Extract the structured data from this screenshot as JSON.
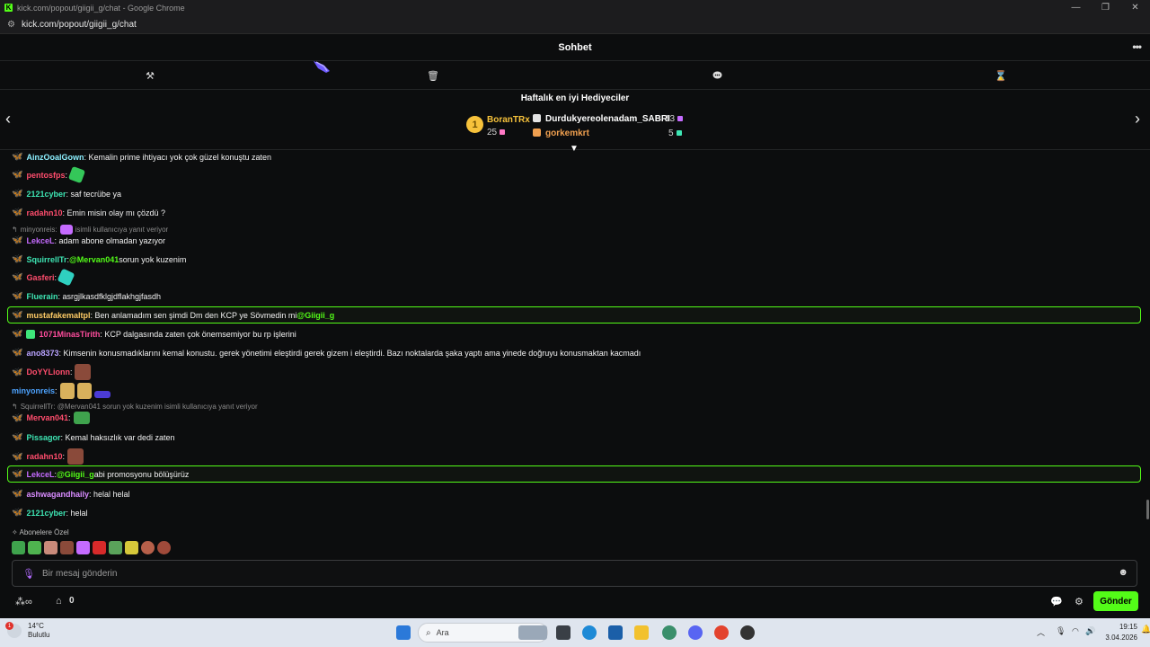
{
  "browser": {
    "title": "kick.com/popout/giigii_g/chat - Google Chrome",
    "url": "kick.com/popout/giigii_g/chat"
  },
  "header": {
    "title": "Sohbet"
  },
  "gifters": {
    "title": "Haftalık en iyi Hediyeciler",
    "first": {
      "rank": "1",
      "name": "BoranTRx",
      "count": "25"
    },
    "second": {
      "name": "Durdukyereolenadam_SABRI",
      "count": "13"
    },
    "third": {
      "name": "gorkemkrt",
      "count": "5"
    }
  },
  "messages": [
    {
      "user": "AinzOoalGown",
      "text": ": Kemalin prime ihtiyacı yok çok güzel konuştu zaten",
      "color": "#8cf0ff"
    },
    {
      "user": "pentosfps",
      "text": ":",
      "color": "#ff4d6d"
    },
    {
      "user": "2121cyber",
      "text": ": saf tecrübe ya",
      "color": "#3ee6b4"
    },
    {
      "user": "radahn10",
      "text": ": Emin misin olay mı çözdü ?",
      "color": "#ff4d6d"
    },
    {
      "reply_user": "minyonreis:",
      "reply_text": "isimli kullanıcıya yanıt veriyor"
    },
    {
      "user": "LekceL",
      "text": ": adam abone olmadan yazıyor",
      "color": "#c56bff"
    },
    {
      "user": "SquirrellTr",
      "text": ": ",
      "mention": "@Mervan041",
      "after": " sorun yok kuzenim",
      "color": "#3ee6b4"
    },
    {
      "user": "Gasferi",
      "text": ":",
      "color": "#ff4d6d"
    },
    {
      "user": "Fluerain",
      "text": ": asrgjlkasdfklgjdflakhgjfasdh",
      "color": "#3ee6b4"
    },
    {
      "user": "mustafakemaltpl",
      "text": ": Ben anlamadım sen şimdi Dm den KCP ye Sövmedin mi ",
      "mention": "@Giigii_g",
      "color": "#ffcc66"
    },
    {
      "user": "1071MinasTirith",
      "text": ": KCP dalgasında zaten çok önemsemiyor bu rp işlerini",
      "color": "#ff4d9d"
    },
    {
      "user": "ano8373",
      "text": ": Kimsenin konusmadıklarını kemal konustu. gerek yönetimi eleştirdi gerek gizem i eleştirdi. Bazı noktalarda şaka yaptı ama yinede doğruyu konusmaktan kacmadı",
      "color": "#b9a3ff"
    },
    {
      "user": "DoYYLionn",
      "text": ":",
      "color": "#ff4d6d"
    },
    {
      "user": "minyonreis",
      "text": ":",
      "color": "#4da3ff"
    },
    {
      "reply_user": "SquirrellTr:",
      "reply_text": "@Mervan041 sorun yok kuzenim isimli kullanıcıya yanıt veriyor"
    },
    {
      "user": "Mervan041",
      "text": ":",
      "color": "#ff4d6d"
    },
    {
      "user": "Pissagor",
      "text": ": Kemal haksızlık var dedi zaten",
      "color": "#3ee6b4"
    },
    {
      "user": "radahn10",
      "text": ":",
      "color": "#ff4d6d"
    },
    {
      "user": "LekceL",
      "text": ": ",
      "mention": "@Giigii_g",
      "after": " abi promosyonu bölüşürüz",
      "color": "#c56bff"
    },
    {
      "user": "ashwagandhaily",
      "text": ": helal helal",
      "color": "#d98cff"
    },
    {
      "user": "2121cyber",
      "text": ": helal",
      "color": "#3ee6b4"
    }
  ],
  "subs": {
    "label": "Abonelere Özel"
  },
  "input": {
    "placeholder": "Bir mesaj gönderin"
  },
  "bottom": {
    "points": "0",
    "send_label": "Gönder"
  },
  "taskbar": {
    "temp": "14°C",
    "weather": "Bulutlu",
    "badge": "1",
    "search_label": "Ara",
    "time": "19:15",
    "date": "3.04.2026"
  },
  "colors": {
    "accent": "#53fc18",
    "background": "#0c0d0e"
  }
}
